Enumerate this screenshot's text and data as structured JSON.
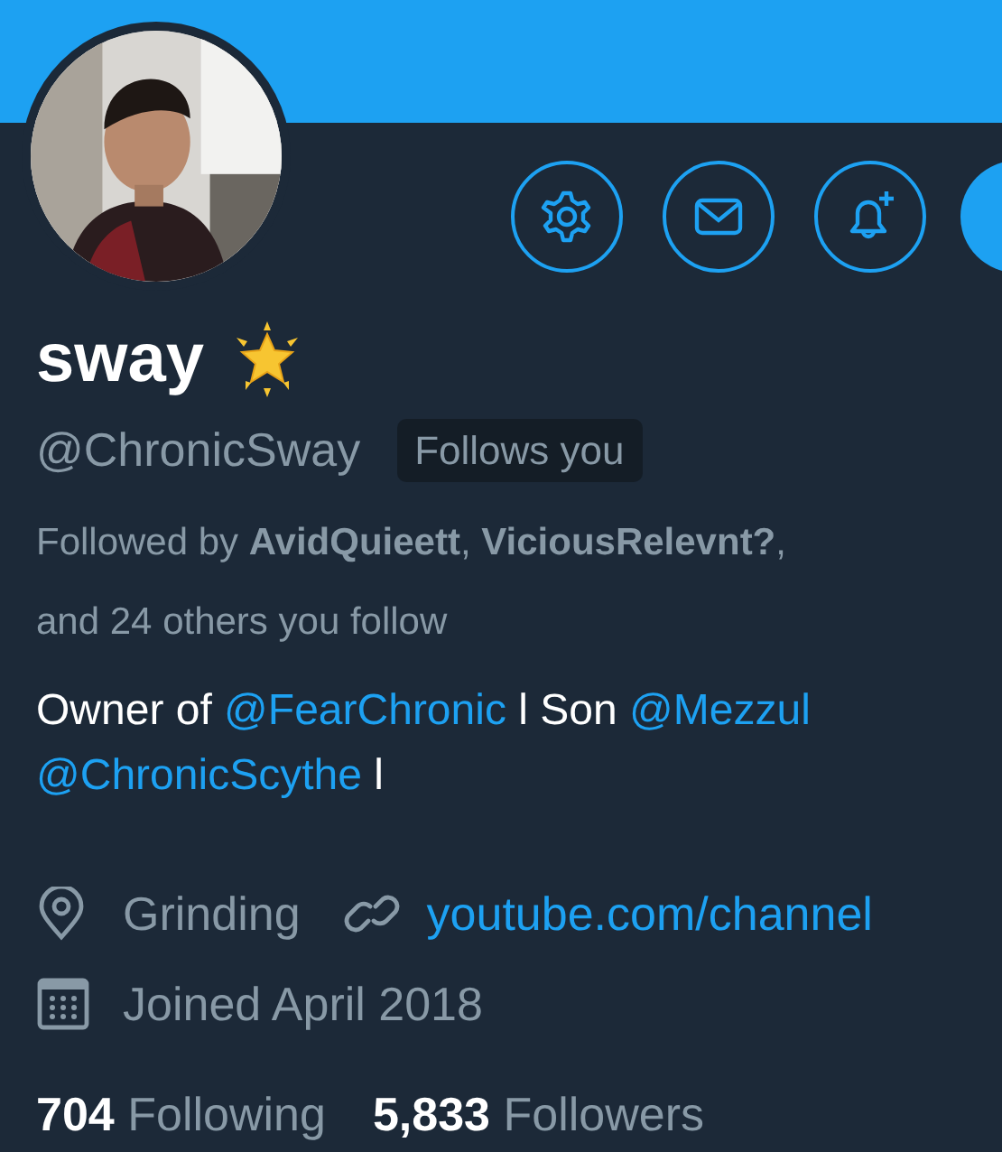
{
  "profile": {
    "name": "sway",
    "handle": "@ChronicSway",
    "follows_you_badge": "Follows you",
    "followed_by": "Followed by **AvidQuieett**, **ViciousRelevnt?**,",
    "followed_by_more": "and 24 others you follow",
    "bio_lines": [
      [
        {
          "kind": "text",
          "text": "Owner of "
        },
        {
          "kind": "mention",
          "text": "@FearChronic"
        },
        {
          "kind": "text",
          "text": " l Son "
        },
        {
          "kind": "mention",
          "text": "@Mezzul"
        }
      ],
      [
        {
          "kind": "mention",
          "text": "@ChronicScythe"
        },
        {
          "kind": "text",
          "text": " l"
        }
      ]
    ],
    "location": "Grinding",
    "website": "youtube.com/channel",
    "joined": "Joined April 2018",
    "stats": [
      {
        "count": "704",
        "label": "Following"
      },
      {
        "count": "5,833",
        "label": "Followers"
      }
    ]
  },
  "action_icons": [
    {
      "kind": "settings"
    },
    {
      "kind": "message"
    },
    {
      "kind": "notify"
    }
  ]
}
